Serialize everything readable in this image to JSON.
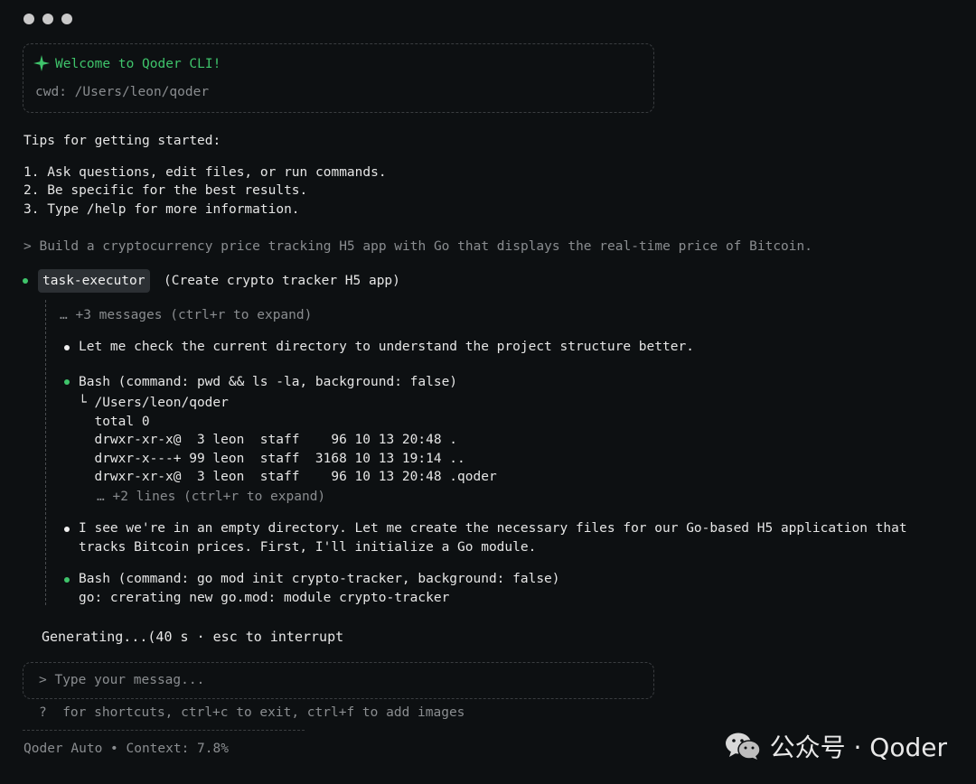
{
  "header": {
    "welcome": "Welcome to Qoder CLI!",
    "cwd": "cwd: /Users/leon/qoder"
  },
  "tips": {
    "title": "Tips for getting started:",
    "items": [
      "1. Ask questions, edit files, or run commands.",
      "2. Be specific for the best results.",
      "3. Type /help for more information."
    ]
  },
  "user_prompt": "> Build a cryptocurrency price tracking H5 app with Go that displays the real-time price of Bitcoin.",
  "task": {
    "badge": "task-executor",
    "description": "(Create crypto tracker H5 app)",
    "collapsed_note": "… +3 messages (ctrl+r to expand)"
  },
  "log": {
    "msg1": "Let me check the current directory to understand the project structure better.",
    "bash1": "Bash (command: pwd && ls -la, background: false)",
    "bash1_output": [
      "└ /Users/leon/qoder",
      "  total 0",
      "  drwxr-xr-x@  3 leon  staff    96 10 13 20:48 .",
      "  drwxr-x---+ 99 leon  staff  3168 10 13 19:14 ..",
      "  drwxr-xr-x@  3 leon  staff    96 10 13 20:48 .qoder"
    ],
    "bash1_more": "… +2 lines (ctrl+r to expand)",
    "msg2_line1": "I see we're in an empty directory. Let me create the necessary files for our Go-based H5 application that",
    "msg2_line2": "tracks Bitcoin prices. First, I'll initialize a Go module.",
    "bash2": "Bash (command: go mod init crypto-tracker, background: false)",
    "bash2_output": "go: crerating new go.mod: module crypto-tracker"
  },
  "status": {
    "generating": "Generating...(40 s · esc to interrupt"
  },
  "input": {
    "placeholder": "> Type your messag..."
  },
  "hints": "?  for shortcuts, ctrl+c to exit, ctrl+f to add images",
  "footer": "Qoder Auto • Context: 7.8%",
  "watermark": {
    "text": "公众号 · Qoder"
  }
}
